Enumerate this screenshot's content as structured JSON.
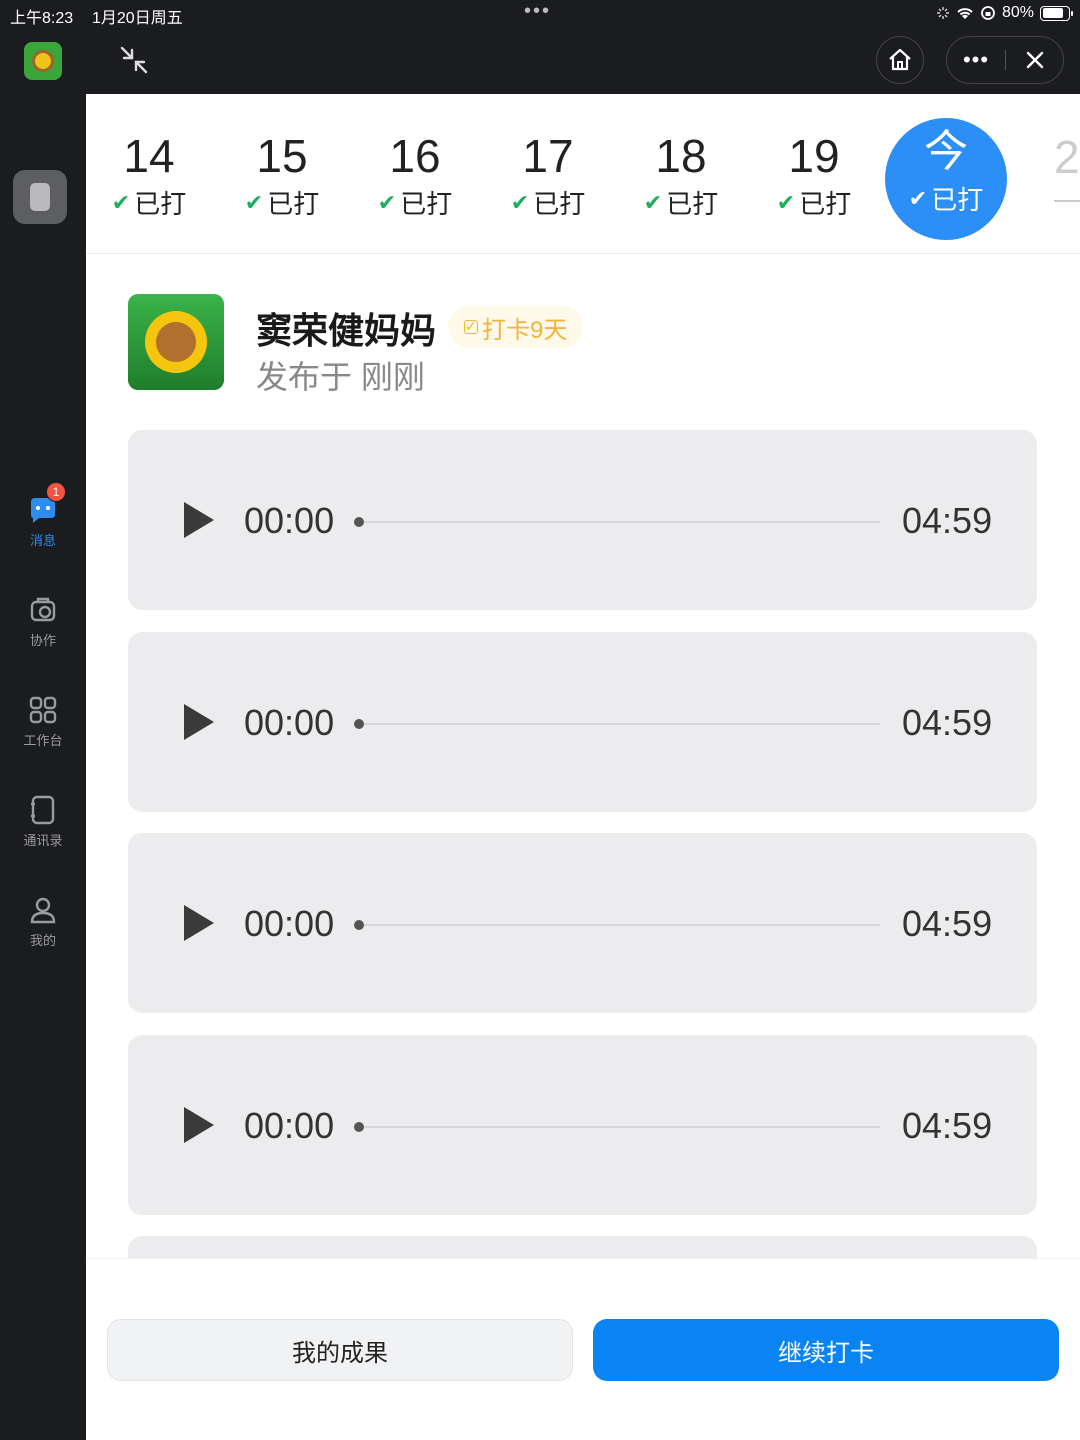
{
  "status_bar": {
    "time": "上午8:23",
    "date": "1月20日周五",
    "dots": "•••",
    "battery": "80%"
  },
  "sidebar": {
    "items": [
      {
        "label": "消息",
        "icon": "chat-icon",
        "badge": "1",
        "active": true
      },
      {
        "label": "协作",
        "icon": "collaboration-icon"
      },
      {
        "label": "工作台",
        "icon": "grid-icon"
      },
      {
        "label": "通讯录",
        "icon": "contacts-icon"
      },
      {
        "label": "我的",
        "icon": "profile-icon"
      }
    ]
  },
  "topbar": {
    "more": "•••"
  },
  "dates": {
    "days": [
      {
        "num": "14",
        "status": "已打"
      },
      {
        "num": "15",
        "status": "已打"
      },
      {
        "num": "16",
        "status": "已打"
      },
      {
        "num": "17",
        "status": "已打"
      },
      {
        "num": "18",
        "status": "已打"
      },
      {
        "num": "19",
        "status": "已打"
      }
    ],
    "today": {
      "num": "今",
      "status": "已打"
    },
    "next_peek": "2",
    "check": "✔"
  },
  "post": {
    "username": "窦荣健妈妈",
    "tag": "打卡9天",
    "published": "发布于 刚刚"
  },
  "audio_items": [
    {
      "current": "00:00",
      "duration": "04:59"
    },
    {
      "current": "00:00",
      "duration": "04:59"
    },
    {
      "current": "00:00",
      "duration": "04:59"
    },
    {
      "current": "00:00",
      "duration": "04:59"
    }
  ],
  "buttons": {
    "my_results": "我的成果",
    "continue": "继续打卡"
  },
  "colors": {
    "accent": "#0a84f5",
    "check_green": "#1fae5a",
    "tag_orange": "#f3b33a",
    "badge_red": "#f3533e"
  }
}
